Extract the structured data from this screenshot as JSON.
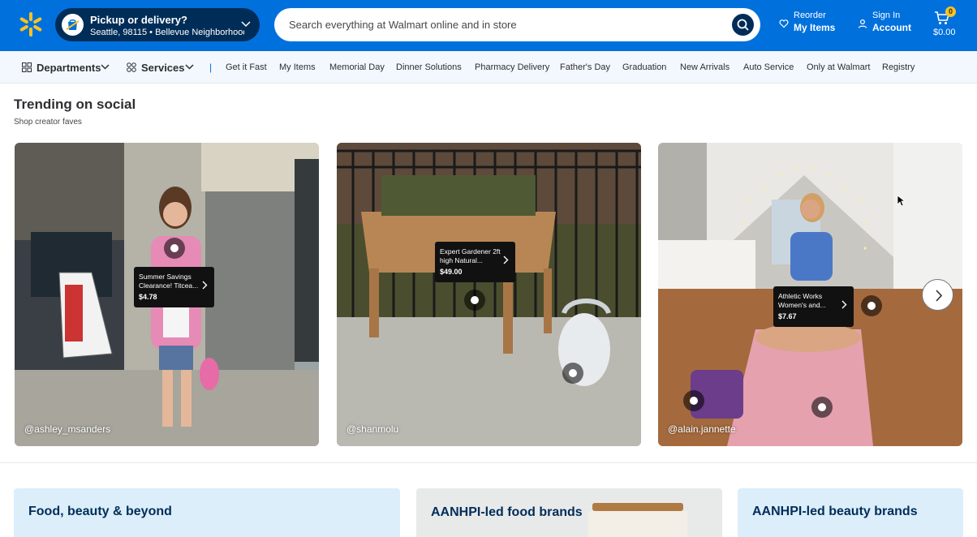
{
  "header": {
    "pickup": {
      "title": "Pickup or delivery?",
      "location": "Seattle, 98115 • Bellevue Neighborhood..."
    },
    "search": {
      "placeholder": "Search everything at Walmart online and in store"
    },
    "reorder": {
      "line1": "Reorder",
      "line2": "My Items"
    },
    "signin": {
      "line1": "Sign In",
      "line2": "Account"
    },
    "cart": {
      "count": "0",
      "total": "$0.00"
    },
    "brand_color": "#0071dc",
    "accent_color": "#ffc220"
  },
  "nav": {
    "departments": "Departments",
    "services": "Services",
    "separator": "|",
    "links": [
      "Get it Fast",
      "My Items",
      "Memorial Day",
      "Dinner Solutions",
      "Pharmacy Delivery",
      "Father's Day",
      "Graduation",
      "New Arrivals",
      "Auto Service",
      "Only at Walmart",
      "Registry"
    ]
  },
  "trending": {
    "title": "Trending on social",
    "subtitle": "Shop creator faves",
    "cards": [
      {
        "handle": "@ashley_msanders",
        "product": {
          "name": "Summer Savings Clearance! Titcea...",
          "price": "$4.78"
        }
      },
      {
        "handle": "@shanmolu",
        "product": {
          "name": "Expert Gardener 2ft high Natural...",
          "price": "$49.00"
        }
      },
      {
        "handle": "@alain.jannette",
        "product": {
          "name": "Athletic Works Women's and...",
          "price": "$7.67"
        }
      }
    ]
  },
  "promos": [
    {
      "title": "Food, beauty & beyond"
    },
    {
      "title": "AANHPI-led food brands"
    },
    {
      "title": "AANHPI-led beauty brands"
    }
  ]
}
